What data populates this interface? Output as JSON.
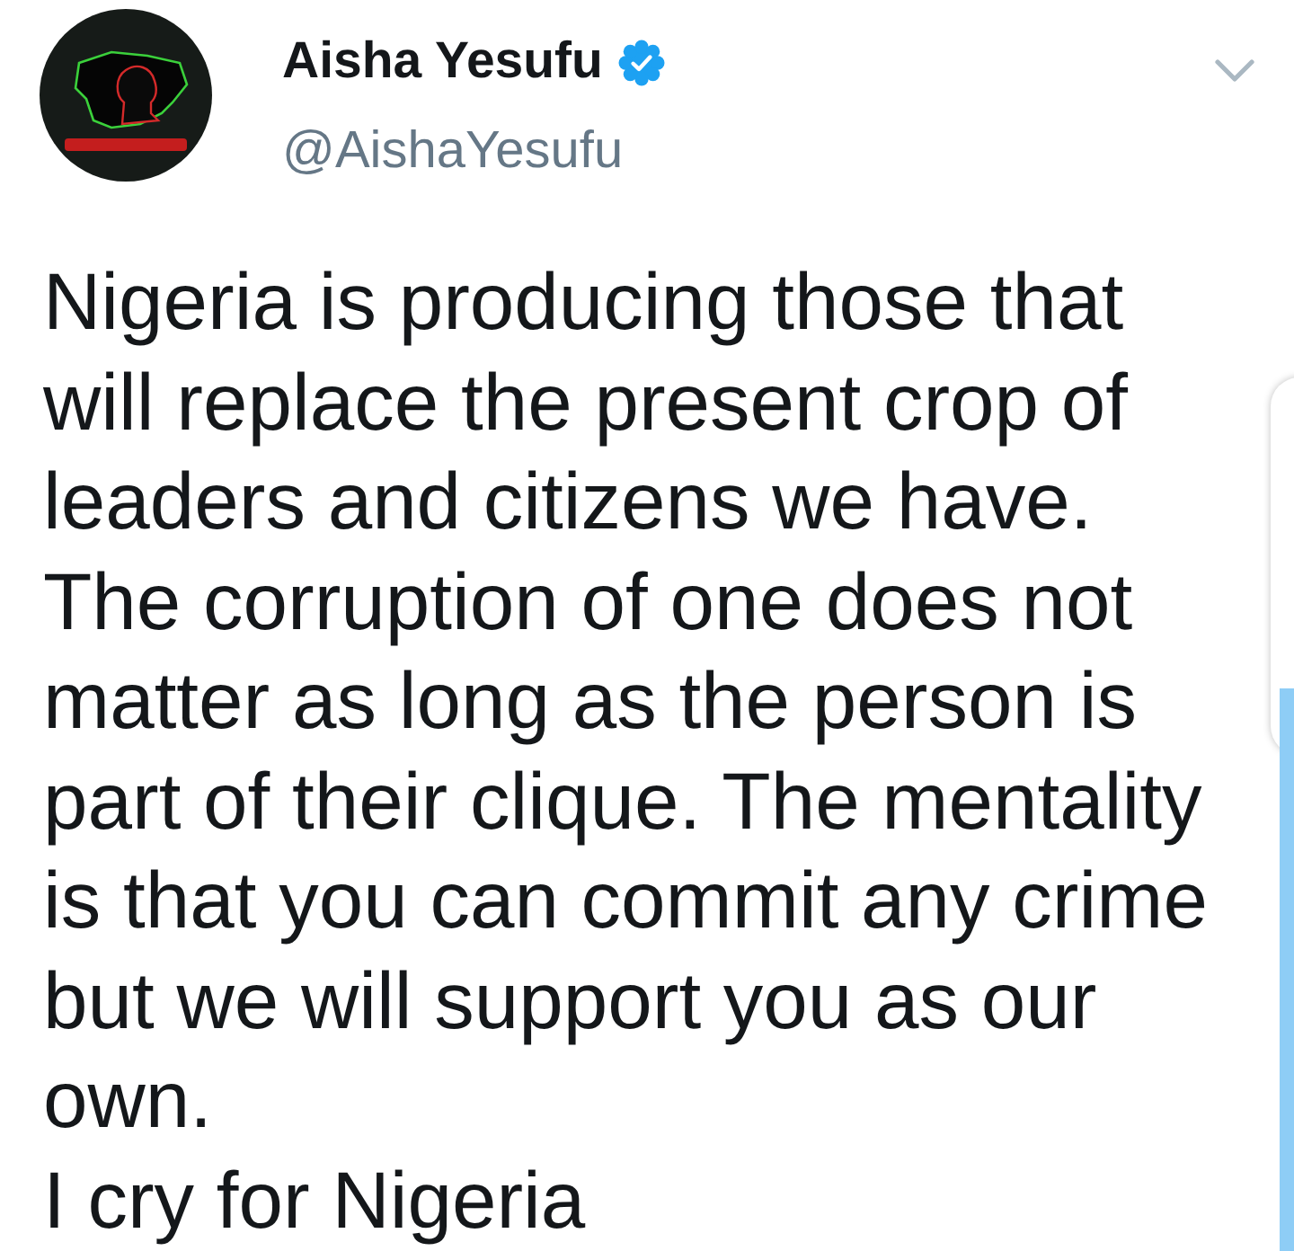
{
  "tweet": {
    "author": {
      "name": "Aisha Yesufu",
      "verified": true,
      "handle": "@AishaYesufu"
    },
    "paragraphs": [
      "Nigeria is producing those that will replace the present crop of leaders and citizens we have.",
      "The corruption of one does not matter as long as the person is part of their clique. The mentality is that you can commit any crime but we will support you as our own.",
      "I cry for Nigeria"
    ]
  }
}
